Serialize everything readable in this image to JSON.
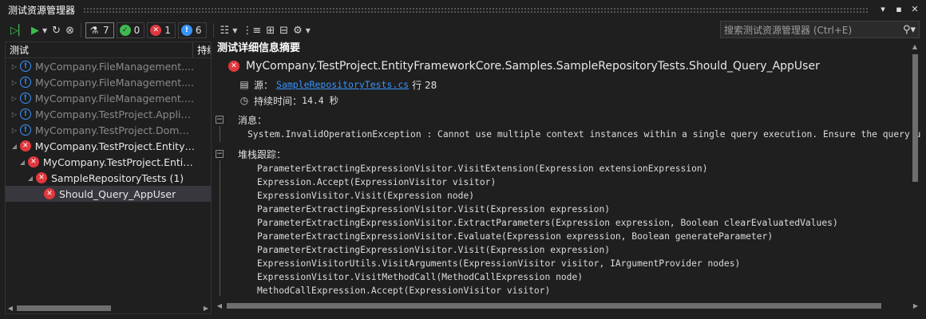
{
  "window": {
    "title": "测试资源管理器"
  },
  "toolbar": {
    "counters": [
      {
        "icon": "flask-icon",
        "value": "7"
      },
      {
        "icon": "passed-icon",
        "value": "0"
      },
      {
        "icon": "failed-icon",
        "value": "1"
      },
      {
        "icon": "info-icon",
        "value": "6"
      }
    ],
    "search_placeholder": "搜索测试资源管理器 (Ctrl+E)"
  },
  "tree": {
    "col_test": "测试",
    "col_duration": "持续",
    "rows": [
      {
        "label": "MyCompany.FileManagement....",
        "status": "info"
      },
      {
        "label": "MyCompany.FileManagement....",
        "status": "info"
      },
      {
        "label": "MyCompany.FileManagement.E...",
        "status": "info"
      },
      {
        "label": "MyCompany.TestProject.Applic...",
        "status": "info"
      },
      {
        "label": "MyCompany.TestProject.Domai...",
        "status": "info"
      },
      {
        "label": "MyCompany.TestProject.EntityF...",
        "status": "fail"
      },
      {
        "label": "MyCompany.TestProject.Entit...",
        "status": "fail"
      },
      {
        "label": "SampleRepositoryTests (1)",
        "status": "fail"
      },
      {
        "label": "Should_Query_AppUser",
        "status": "fail"
      }
    ]
  },
  "detail": {
    "header": "测试详细信息摘要",
    "test_name": "MyCompany.TestProject.EntityFrameworkCore.Samples.SampleRepositoryTests.Should_Query_AppUser",
    "source_label": "源：",
    "source_file": "SampleRepositoryTests.cs",
    "line_label": "行 28",
    "duration_label": "持续时间：",
    "duration_value": "14.4 秒",
    "message_label": "消息：",
    "message": "System.InvalidOperationException : Cannot use multiple context instances within a single query execution. Ensure the query uses",
    "stack_label": "堆栈跟踪：",
    "stack": [
      "ParameterExtractingExpressionVisitor.VisitExtension(Expression extensionExpression)",
      "Expression.Accept(ExpressionVisitor visitor)",
      "ExpressionVisitor.Visit(Expression node)",
      "ParameterExtractingExpressionVisitor.Visit(Expression expression)",
      "ParameterExtractingExpressionVisitor.ExtractParameters(Expression expression, Boolean clearEvaluatedValues)",
      "ParameterExtractingExpressionVisitor.Evaluate(Expression expression, Boolean generateParameter)",
      "ParameterExtractingExpressionVisitor.Visit(Expression expression)",
      "ExpressionVisitorUtils.VisitArguments(ExpressionVisitor visitor, IArgumentProvider nodes)",
      "ExpressionVisitor.VisitMethodCall(MethodCallExpression node)",
      "MethodCallExpression.Accept(ExpressionVisitor visitor)"
    ]
  }
}
